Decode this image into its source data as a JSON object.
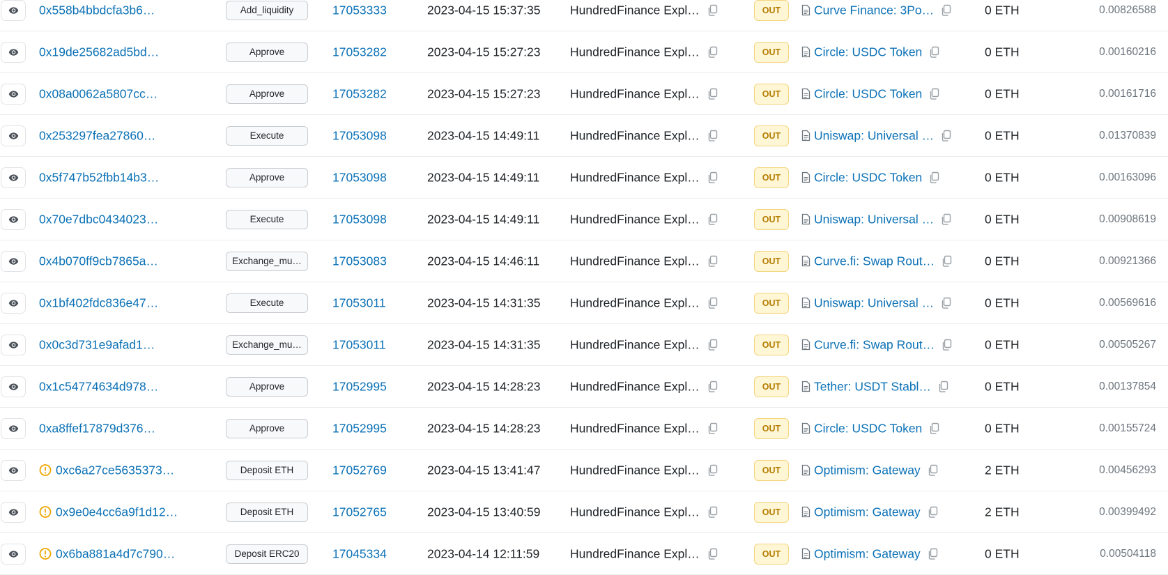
{
  "colors": {
    "link": "#0b71b6",
    "badge_bg": "#fff6d6",
    "badge_text": "#b47d00",
    "warning": "#f0a500"
  },
  "icons": {
    "view": "eye-icon",
    "copy": "copy-icon",
    "contract": "document-icon",
    "warning": "warning-circle-icon"
  },
  "transactions": [
    {
      "hash": "0x558b4bbdcfa3b6…",
      "method": "Add_liquidity",
      "block": "17053333",
      "age": "2023-04-15 15:37:35",
      "from": "HundredFinance Expl…",
      "direction": "OUT",
      "to": "Curve Finance: 3Po…",
      "value": "0 ETH",
      "fee": "0.00826588",
      "warning": false
    },
    {
      "hash": "0x19de25682ad5bd…",
      "method": "Approve",
      "block": "17053282",
      "age": "2023-04-15 15:27:23",
      "from": "HundredFinance Expl…",
      "direction": "OUT",
      "to": "Circle: USDC Token",
      "value": "0 ETH",
      "fee": "0.00160216",
      "warning": false
    },
    {
      "hash": "0x08a0062a5807cc…",
      "method": "Approve",
      "block": "17053282",
      "age": "2023-04-15 15:27:23",
      "from": "HundredFinance Expl…",
      "direction": "OUT",
      "to": "Circle: USDC Token",
      "value": "0 ETH",
      "fee": "0.00161716",
      "warning": false
    },
    {
      "hash": "0x253297fea27860…",
      "method": "Execute",
      "block": "17053098",
      "age": "2023-04-15 14:49:11",
      "from": "HundredFinance Expl…",
      "direction": "OUT",
      "to": "Uniswap: Universal …",
      "value": "0 ETH",
      "fee": "0.01370839",
      "warning": false
    },
    {
      "hash": "0x5f747b52fbb14b3…",
      "method": "Approve",
      "block": "17053098",
      "age": "2023-04-15 14:49:11",
      "from": "HundredFinance Expl…",
      "direction": "OUT",
      "to": "Circle: USDC Token",
      "value": "0 ETH",
      "fee": "0.00163096",
      "warning": false
    },
    {
      "hash": "0x70e7dbc0434023…",
      "method": "Execute",
      "block": "17053098",
      "age": "2023-04-15 14:49:11",
      "from": "HundredFinance Expl…",
      "direction": "OUT",
      "to": "Uniswap: Universal …",
      "value": "0 ETH",
      "fee": "0.00908619",
      "warning": false
    },
    {
      "hash": "0x4b070ff9cb7865a…",
      "method": "Exchange_mu…",
      "block": "17053083",
      "age": "2023-04-15 14:46:11",
      "from": "HundredFinance Expl…",
      "direction": "OUT",
      "to": "Curve.fi: Swap Rout…",
      "value": "0 ETH",
      "fee": "0.00921366",
      "warning": false
    },
    {
      "hash": "0x1bf402fdc836e47…",
      "method": "Execute",
      "block": "17053011",
      "age": "2023-04-15 14:31:35",
      "from": "HundredFinance Expl…",
      "direction": "OUT",
      "to": "Uniswap: Universal …",
      "value": "0 ETH",
      "fee": "0.00569616",
      "warning": false
    },
    {
      "hash": "0x0c3d731e9afad1…",
      "method": "Exchange_mu…",
      "block": "17053011",
      "age": "2023-04-15 14:31:35",
      "from": "HundredFinance Expl…",
      "direction": "OUT",
      "to": "Curve.fi: Swap Rout…",
      "value": "0 ETH",
      "fee": "0.00505267",
      "warning": false
    },
    {
      "hash": "0x1c54774634d978…",
      "method": "Approve",
      "block": "17052995",
      "age": "2023-04-15 14:28:23",
      "from": "HundredFinance Expl…",
      "direction": "OUT",
      "to": "Tether: USDT Stabl…",
      "value": "0 ETH",
      "fee": "0.00137854",
      "warning": false
    },
    {
      "hash": "0xa8ffef17879d376…",
      "method": "Approve",
      "block": "17052995",
      "age": "2023-04-15 14:28:23",
      "from": "HundredFinance Expl…",
      "direction": "OUT",
      "to": "Circle: USDC Token",
      "value": "0 ETH",
      "fee": "0.00155724",
      "warning": false
    },
    {
      "hash": "0xc6a27ce5635373…",
      "method": "Deposit ETH",
      "block": "17052769",
      "age": "2023-04-15 13:41:47",
      "from": "HundredFinance Expl…",
      "direction": "OUT",
      "to": "Optimism: Gateway",
      "value": "2 ETH",
      "fee": "0.00456293",
      "warning": true
    },
    {
      "hash": "0x9e0e4cc6a9f1d12…",
      "method": "Deposit ETH",
      "block": "17052765",
      "age": "2023-04-15 13:40:59",
      "from": "HundredFinance Expl…",
      "direction": "OUT",
      "to": "Optimism: Gateway",
      "value": "2 ETH",
      "fee": "0.00399492",
      "warning": true
    },
    {
      "hash": "0x6ba881a4d7c790…",
      "method": "Deposit ERC20",
      "block": "17045334",
      "age": "2023-04-14 12:11:59",
      "from": "HundredFinance Expl…",
      "direction": "OUT",
      "to": "Optimism: Gateway",
      "value": "0 ETH",
      "fee": "0.00504118",
      "warning": true
    }
  ]
}
